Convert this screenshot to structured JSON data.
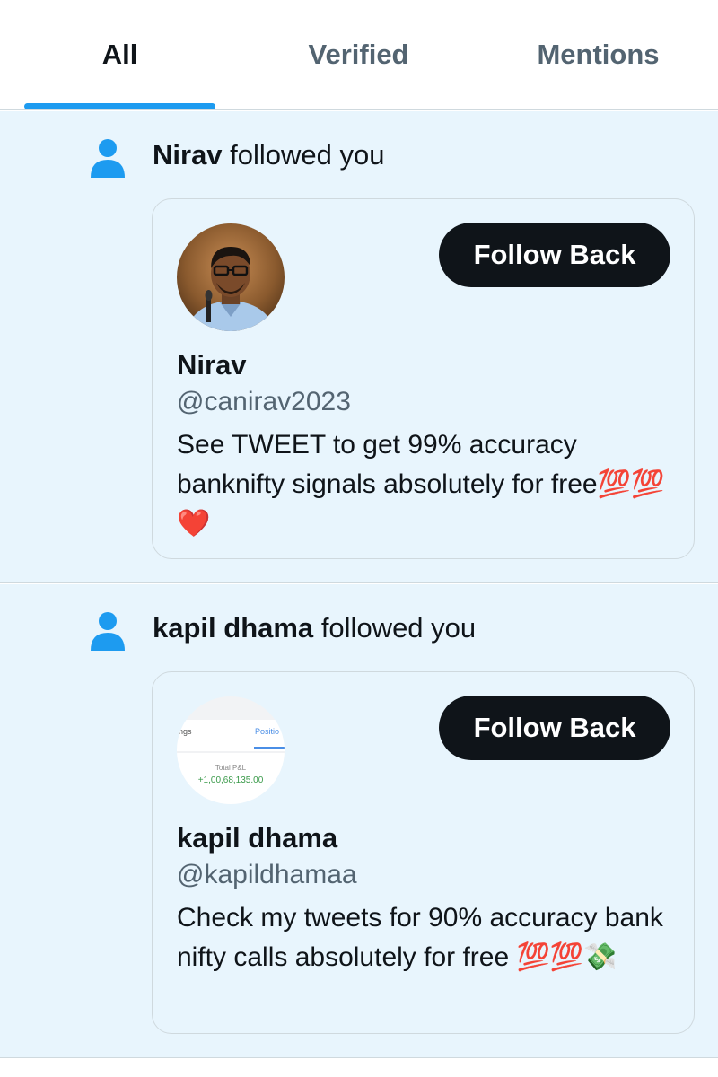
{
  "tabs": [
    {
      "label": "All",
      "active": true
    },
    {
      "label": "Verified",
      "active": false
    },
    {
      "label": "Mentions",
      "active": false
    }
  ],
  "notifications": [
    {
      "type": "follow",
      "actor_name": "Nirav",
      "action_text": "followed you",
      "card": {
        "name": "Nirav",
        "handle": "@canirav2023",
        "bio": "See TWEET to get 99% accuracy banknifty signals absolutely for free💯💯❤️",
        "button_label": "Follow Back",
        "avatar": "person-photo"
      }
    },
    {
      "type": "follow",
      "actor_name": "kapil dhama",
      "action_text": "followed you",
      "card": {
        "name": "kapil dhama",
        "handle": "@kapildhamaa",
        "bio": "Check my tweets for 90% accuracy bank nifty calls absolutely for free 💯💯💸",
        "button_label": "Follow Back",
        "avatar": "pnl-screenshot",
        "avatar_text": {
          "tab_left": "ings",
          "tab_right": "Positio",
          "pnl_label": "Total P&L",
          "pnl_value": "+1,00,68,135.00"
        }
      }
    }
  ],
  "colors": {
    "accent": "#1d9bf0",
    "notification_bg": "#e8f5fd",
    "button_bg": "#0f1419",
    "secondary_text": "#536471"
  },
  "icons": {
    "notification_type": "person-icon"
  }
}
